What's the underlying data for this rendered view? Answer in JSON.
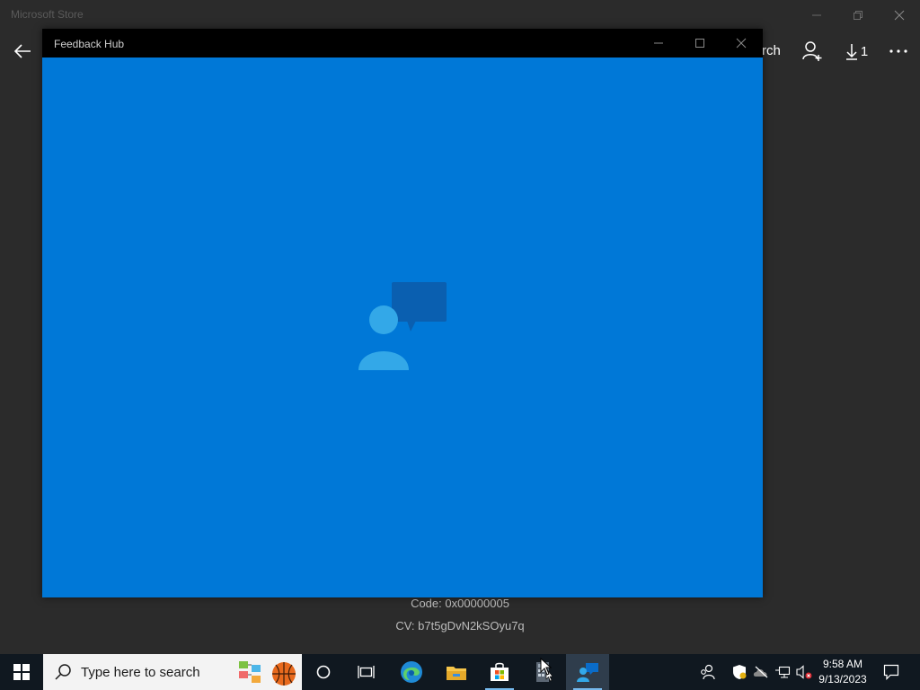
{
  "store": {
    "title": "Microsoft Store",
    "search_fragment": "rch",
    "downloads_count": "1"
  },
  "error": {
    "code": "Code: 0x00000005",
    "cv": "CV: b7t5gDvN2kSOyu7q"
  },
  "feedback_hub": {
    "title": "Feedback Hub",
    "background_color": "#0078d7"
  },
  "taskbar": {
    "search_placeholder": "Type here to search",
    "time": "9:58 AM",
    "date": "9/13/2023",
    "apps": [
      "cortana-icon",
      "task-view-icon",
      "edge-icon",
      "file-explorer-icon",
      "microsoft-store-icon",
      "calculator-icon",
      "feedback-hub-icon"
    ]
  }
}
